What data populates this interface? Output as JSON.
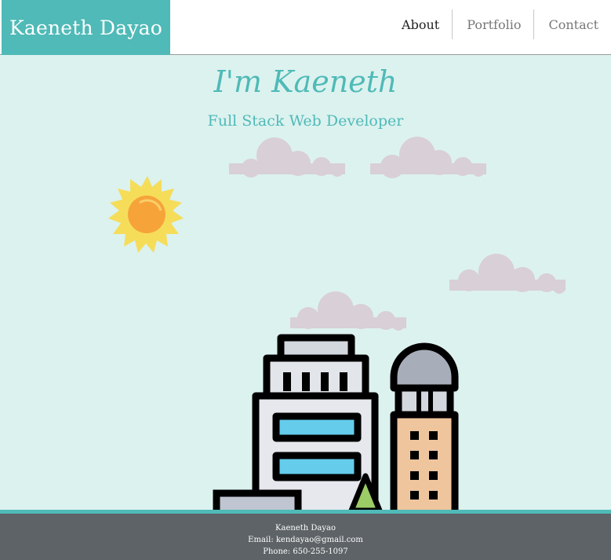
{
  "header": {
    "brand": "Kaeneth Dayao",
    "nav": [
      "About",
      "Portfolio",
      "Contact"
    ]
  },
  "hero": {
    "title": "I'm Kaeneth",
    "subtitle": "Full Stack Web Developer"
  },
  "footer": {
    "name": "Kaeneth Dayao",
    "email": "Email: kendayao@gmail.com",
    "phone": "Phone: 650-255-1097"
  },
  "colors": {
    "accent": "#4fbab7",
    "background": "#dcf2ef",
    "footer": "#5d6366",
    "cloud": "#d9cfd6",
    "sun": "#f5dd5a",
    "sun_core": "#f4a33b"
  }
}
